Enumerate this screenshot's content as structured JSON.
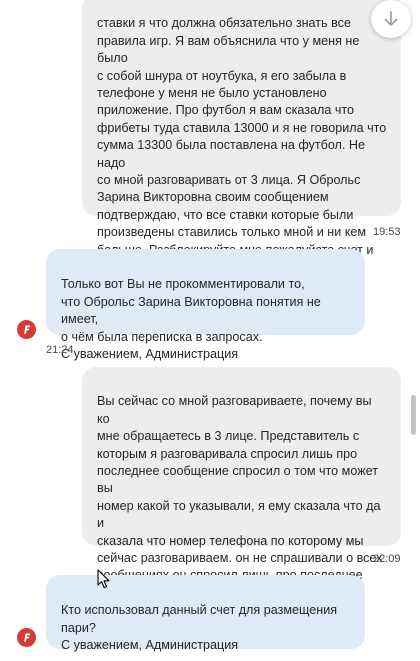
{
  "messages": [
    {
      "direction": "outgoing",
      "text": "ставки я что должна обязательно знать все\nправила игр. Я вам объяснила что у меня не было\nс собой шнура от ноутбука, я его забыла в\nтелефоне у меня не было установлено\nприложение. Про футбол я вам сказала что\nфрибеты туда ставила 13000 и я не говорила что\nсумма 13300 была поставлена на футбол. Не надо\nсо мной разговаривать от 3 лица. Я Оброльс\nЗарина Викторовна своим сообщением\nподтверждаю, что все ставки которые были\nпроизведены ставились только мной и ни кем\nбольше. Разблокируйте мне пожалуйста счет и\nотдайте мои деньги.",
      "time": "19:53"
    },
    {
      "direction": "incoming",
      "text": "Только вот Вы не прокомментировали то,\nчто Оброльс Зарина Викторовна понятия не имеет,\nо чём была переписка в запросах.\nС уважением, Администрация",
      "time": "21:24"
    },
    {
      "direction": "outgoing",
      "text": "Вы сейчас со мной разговариваете, почему вы ко\nмне обращаетесь в 3 лице. Представитель с\nкоторым я разговаривала спросил лишь про\nпоследнее сообщение спросил о том что может вы\nномер какой то указывали, я ему сказала что да и\nсказала что номер телефона по которому мы\nсейчас разговариваем. он не спрашивали о всех\nсообщениях он спросил лишь про последнее\nсообщение.  Как я могу не знать о переписке если\nя постоянно с вами общаюсь",
      "time": "22:09"
    },
    {
      "direction": "incoming",
      "text": "Кто использовал данный счет для размещения\nпари?\nС уважением, Администрация",
      "time": ""
    }
  ],
  "icons": {
    "scroll_down": "arrow-down-icon",
    "avatar": "fonbet-f-logo-icon",
    "cursor": "mouse-pointer-icon"
  },
  "colors": {
    "outgoing_bubble": "#ededed",
    "incoming_bubble": "#dfeaf6",
    "avatar": "#d63a3a"
  }
}
